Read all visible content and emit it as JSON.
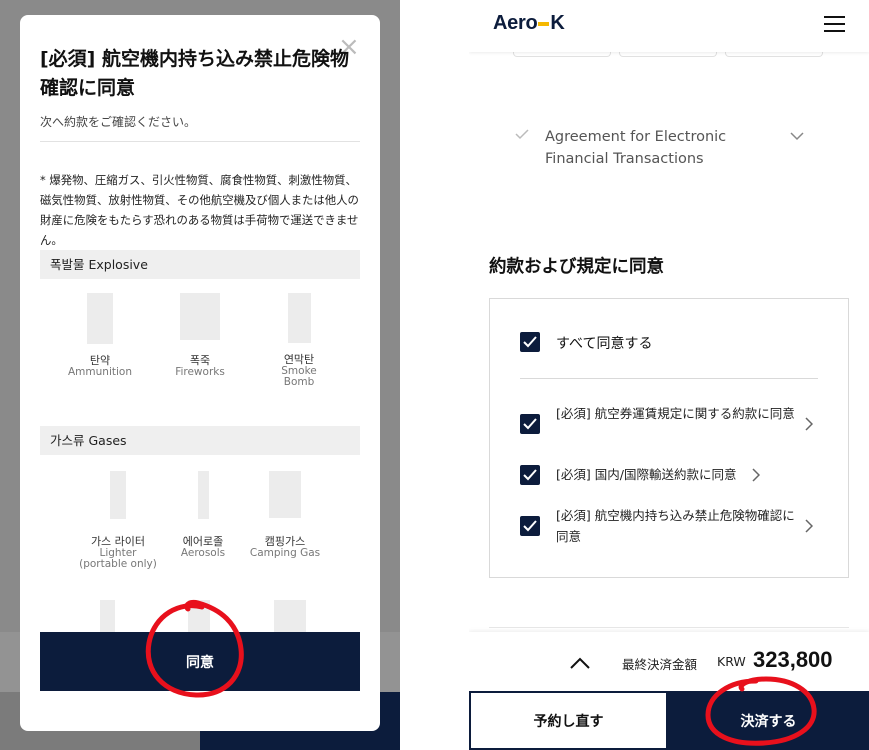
{
  "modal": {
    "title": "[必須] 航空機内持ち込み禁止危険物確認に同意",
    "subtitle": "次へ約款をご確認ください。",
    "warning": "* 爆発物、圧縮ガス、引火性物質、腐食性物質、刺激性物質、磁気性物質、放射性物質、その他航空機及び個人または他人の財産に危険をもたらす恐れのある物質は手荷物で運送できません。",
    "categories": [
      {
        "label": "폭발물 Explosive",
        "items": [
          {
            "ko": "탄약",
            "en": "Ammunition"
          },
          {
            "ko": "폭죽",
            "en": "Fireworks"
          },
          {
            "ko": "연막탄",
            "en": "Smoke Bomb"
          }
        ]
      },
      {
        "label": "가스류 Gases",
        "items": [
          {
            "ko": "가스 라이터",
            "en": "Lighter (portable only)"
          },
          {
            "ko": "에어로졸",
            "en": "Aerosols"
          },
          {
            "ko": "캠핑가스",
            "en": "Camping Gas"
          }
        ]
      }
    ],
    "agree_button": "同意"
  },
  "header": {
    "logo_left": "Aero",
    "logo_right": "K"
  },
  "efta": {
    "label": "Agreement for Electronic Financial Transactions"
  },
  "terms": {
    "section_title": "約款および規定に同意",
    "all_label": "すべて同意する",
    "items": [
      {
        "label": "[必須] 航空券運賃規定に関する約款に同意"
      },
      {
        "label": "[必須] 国内/国際輸送約款に同意"
      },
      {
        "label": "[必須] 航空機内持ち込み禁止危険物確認に同意"
      }
    ]
  },
  "footer": {
    "total_label": "最終決済金額",
    "currency": "KRW",
    "amount": "323,800",
    "rebook_button": "予約し直す",
    "pay_button": "決済する"
  },
  "colors": {
    "navy": "#0c1c3c",
    "logo_accent": "#f5b800",
    "annotation": "#e8101c"
  }
}
